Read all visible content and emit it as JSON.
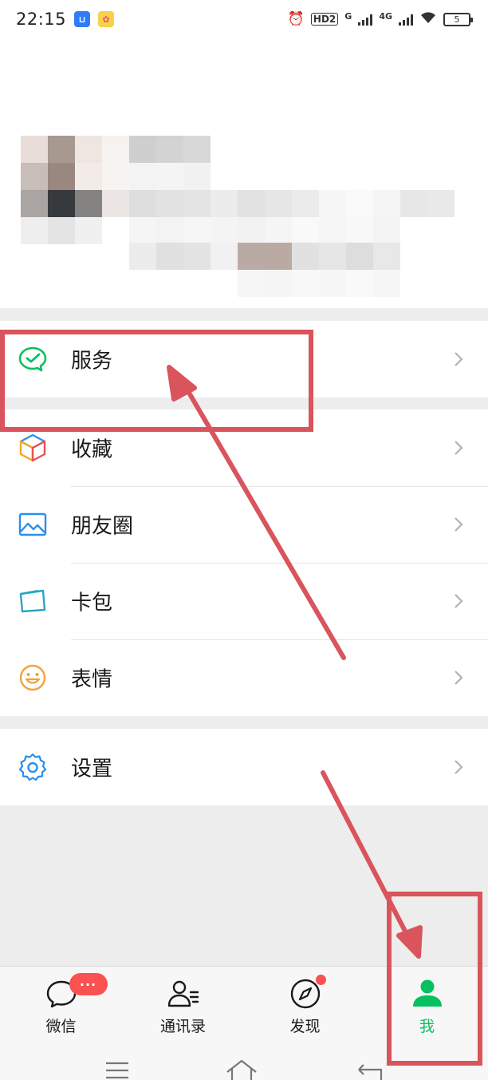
{
  "status_bar": {
    "time": "22:15",
    "network_hd": "HD2",
    "network_g": "G",
    "network_4g": "4G",
    "battery": "5"
  },
  "menu": {
    "services": "服务",
    "favorites": "收藏",
    "moments": "朋友圈",
    "cards": "卡包",
    "stickers": "表情",
    "settings": "设置"
  },
  "tabs": [
    {
      "label": "微信",
      "badge": "···"
    },
    {
      "label": "通讯录"
    },
    {
      "label": "发现"
    },
    {
      "label": "我"
    }
  ],
  "colors": {
    "accent_green": "#07c160",
    "annotation_red": "#d9545c",
    "badge_red": "#fa5151",
    "background": "#ededed"
  },
  "icons": {
    "services": "wechat-pay-check-icon",
    "favorites": "cube-icon",
    "moments": "photo-icon",
    "cards": "card-icon",
    "stickers": "smiley-icon",
    "settings": "gear-icon",
    "tab_chats": "chat-bubble-icon",
    "tab_contacts": "contacts-icon",
    "tab_discover": "compass-icon",
    "tab_me": "person-icon"
  }
}
